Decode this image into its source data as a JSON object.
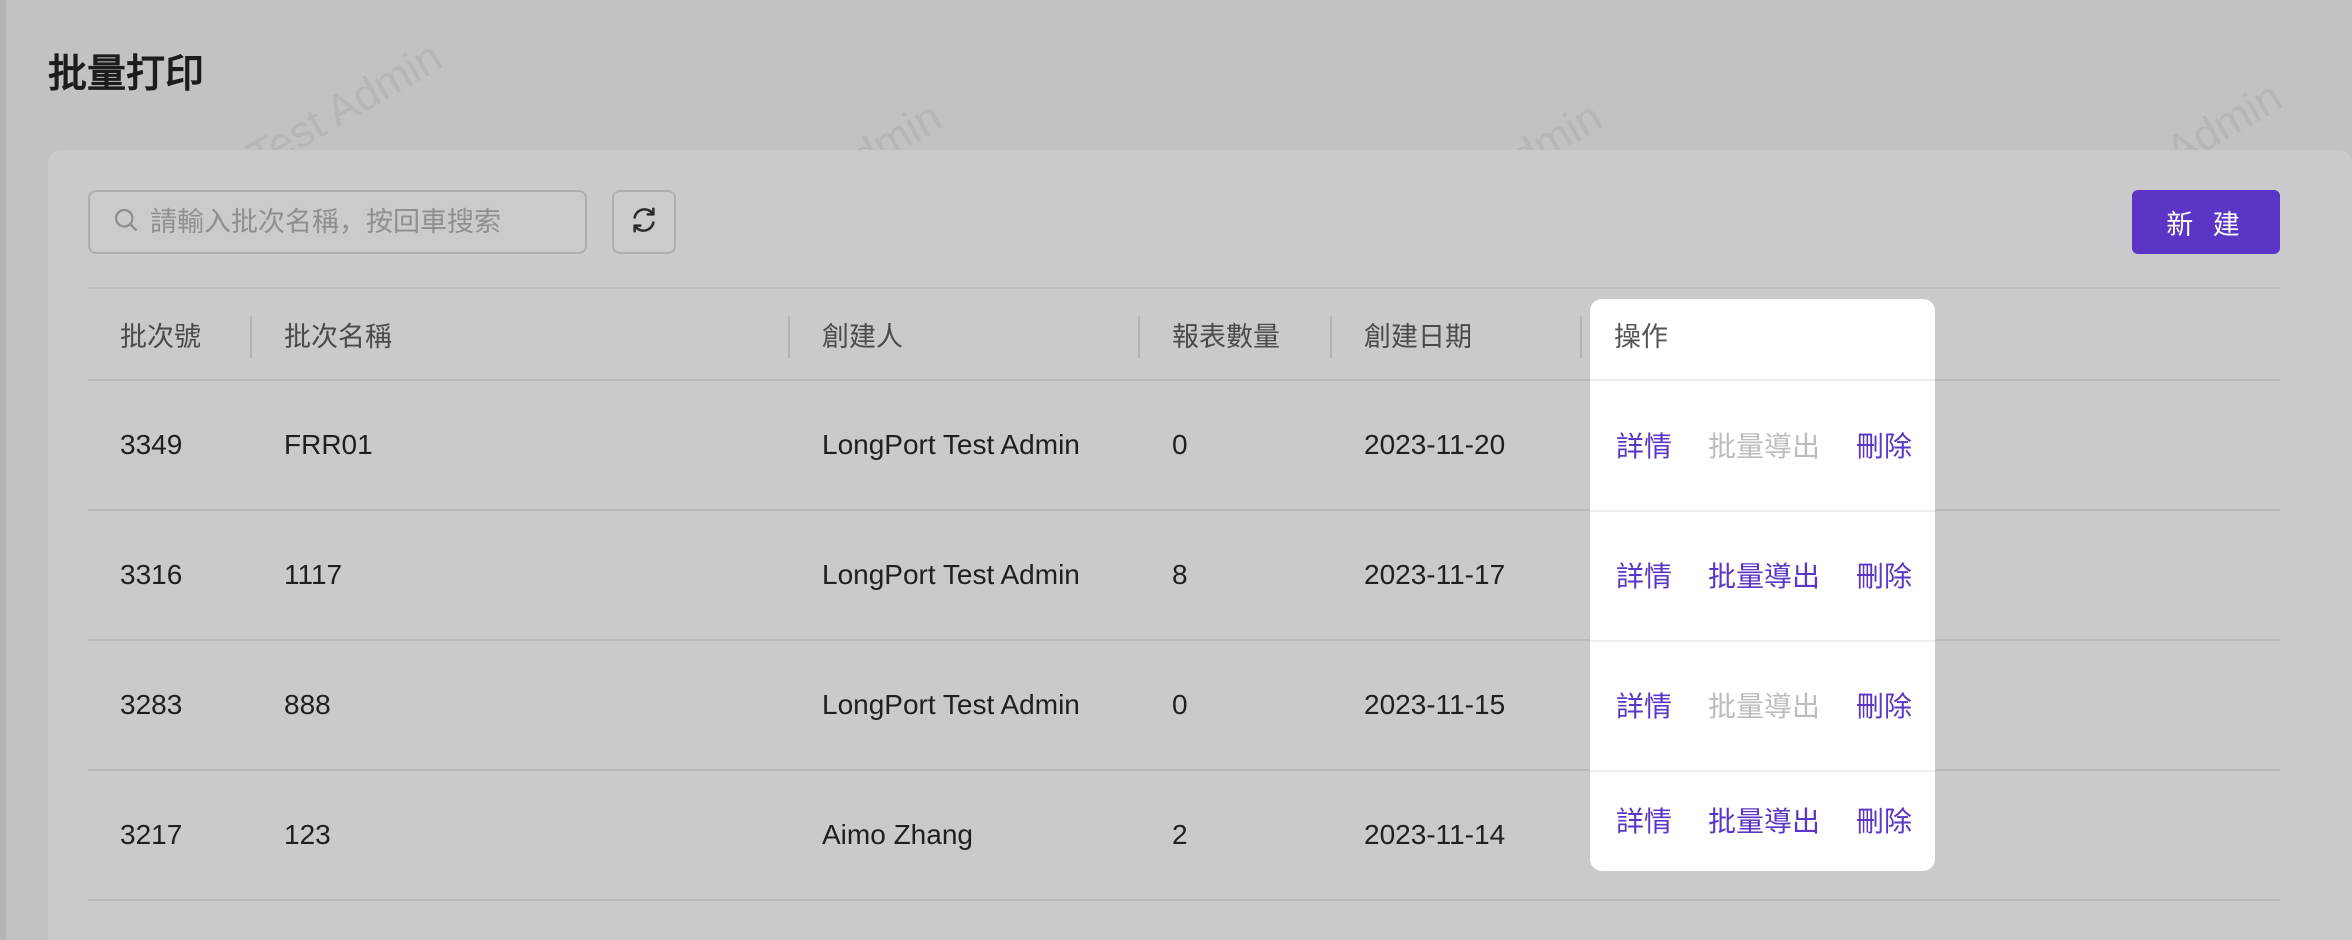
{
  "page": {
    "title": "批量打印"
  },
  "toolbar": {
    "search_placeholder": "請輸入批次名稱，按回車搜索",
    "search_value": "",
    "new_label": "新 建"
  },
  "watermark_text": "LongPort Test Admin",
  "colors": {
    "accent": "#5b35c6",
    "disabled": "#bdbdbd"
  },
  "table": {
    "columns": [
      "批次號",
      "批次名稱",
      "創建人",
      "報表數量",
      "創建日期",
      "操作"
    ],
    "rows": [
      {
        "batch_no": "3349",
        "name": "FRR01",
        "creator": "LongPort Test Admin",
        "count": "0",
        "date": "2023-11-20",
        "ops": {
          "detail": "詳情",
          "export": "批量導出",
          "delete": "刪除",
          "export_enabled": false
        }
      },
      {
        "batch_no": "3316",
        "name": "1117",
        "creator": "LongPort Test Admin",
        "count": "8",
        "date": "2023-11-17",
        "ops": {
          "detail": "詳情",
          "export": "批量導出",
          "delete": "刪除",
          "export_enabled": true
        }
      },
      {
        "batch_no": "3283",
        "name": "888",
        "creator": "LongPort Test Admin",
        "count": "0",
        "date": "2023-11-15",
        "ops": {
          "detail": "詳情",
          "export": "批量導出",
          "delete": "刪除",
          "export_enabled": false
        }
      },
      {
        "batch_no": "3217",
        "name": "123",
        "creator": "Aimo Zhang",
        "count": "2",
        "date": "2023-11-14",
        "ops": {
          "detail": "詳情",
          "export": "批量導出",
          "delete": "刪除",
          "export_enabled": true
        }
      }
    ]
  }
}
